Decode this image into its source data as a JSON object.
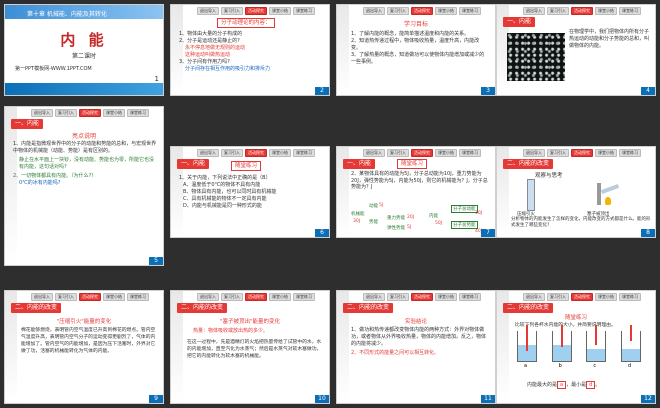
{
  "slides": [
    {
      "num": "1",
      "chapter": "第十章 机械能、内能及其转化",
      "title": "内 能",
      "subtitle": "第二课时",
      "footer": "第一PPT模板网-WWW.1PPT.COM"
    },
    {
      "num": "2",
      "tabs": [
        "退出导入",
        "复习引入",
        "活动探究",
        "课堂小结",
        "课堂练习"
      ],
      "heading": "分子动理论的内容：",
      "items": [
        "1、物体由大量的分子构成的",
        "2、分子是运动还是静止的?",
        "永不停息地做无规则的运动",
        "这种运动叫做热运动",
        "3、分子间有作用力吗?",
        "分子间存在相互作用的吸引力和排斥力"
      ]
    },
    {
      "num": "3",
      "tabs": [
        "退出导入",
        "复习引入",
        "活动探究",
        "课堂小结",
        "课堂练习"
      ],
      "heading": "学习目标",
      "items": [
        "1、了解内能的概念，能简单描述温度和内能的关系。",
        "2、知道热传递过程中，物体吸收热量，温度升高，内能改变。",
        "3、了解热量的概念，知道做功可以使物体内能增加或减少的一些事例。"
      ]
    },
    {
      "num": "4",
      "tabs": [
        "退出导入",
        "复习引入",
        "活动探究",
        "课堂小结",
        "课堂练习"
      ],
      "tag": "一、内能",
      "text": "在物理学中，我们把物体内所有分子热运动的动能和分子势能的总和，叫做物体的内能。"
    },
    {
      "num": "5",
      "tabs": [
        "退出导入",
        "复习引入",
        "活动探究",
        "课堂小结",
        "课堂练习"
      ],
      "tag": "一、内能",
      "heading": "亮点说明",
      "items": [
        "1、内能是指微观世界中的分子的动能和势能的总和，与宏观世界中物体的机械能（动能、势能）是有区别的。",
        "静止在水平面上一块钞，没有动能、势能也为零，所能它也没有内能，这句话对吗?",
        "2、一切物体都具有内能。（为什么?）",
        "0℃的冰有内能吗?"
      ]
    },
    {
      "num": "6",
      "tabs": [
        "退出导入",
        "复习引入",
        "活动探究",
        "课堂小结",
        "课堂练习"
      ],
      "tag": "一、内能",
      "heading": "随堂练习",
      "items": [
        "1、关于内能，下列说法中正确的是（B）",
        "A、温度低于0℃的物体不具有内能",
        "B、物体具有内能，也可以同时具有机械能",
        "C、具有机械能的物体不一定具有内能",
        "D、内能与机械能是同一种形式的能"
      ]
    },
    {
      "num": "7",
      "tabs": [
        "退出导入",
        "复习引入",
        "活动探究",
        "课堂小结",
        "课堂练习"
      ],
      "tag": "一、内能",
      "heading": "随堂练习",
      "items": [
        "2、某物体具有的动能为5J，分子总动能为10J，重力势能为20J，弹性势能为5J，内能为50J，则它的机械能为？J，分子总势能为？J"
      ],
      "labels": [
        "动能",
        "机械能",
        "势能",
        "重力势能",
        "弹性势能",
        "内能",
        "分子总动能",
        "分子总势能",
        "5J",
        "20J",
        "5J",
        "30J",
        "50J",
        "10J",
        "40J"
      ]
    },
    {
      "num": "8",
      "tabs": [
        "退出导入",
        "复习引入",
        "活动探究",
        "课堂小结",
        "课堂练习"
      ],
      "tag": "二、内能的改变",
      "heading": "观察与思考",
      "captions": [
        "压缩引火",
        "塞子被顶出"
      ],
      "text": "分析物体的内能发生了怎样的变化，内能改变的方式都是什么。能的形式发生了哪些变化?"
    },
    {
      "num": "9",
      "tabs": [
        "退出导入",
        "复习引入",
        "活动探究",
        "课堂小结",
        "课堂练习"
      ],
      "tag": "二、内能的改变",
      "heading": "\"压缩引火\"能量的变化",
      "text": "棉花能够燃烧，表明管内空气温度已升高到棉花的燃点。管内空气温度升高，表明管内空气分子的运动变得更剧烈了，气体的内能增加了。管内空气的内能增加，是因为压下活塞时，外界对它做了功，活塞的机械能转化为气体的内能。"
    },
    {
      "num": "10",
      "tabs": [
        "退出导入",
        "复习引入",
        "活动探究",
        "课堂小结",
        "课堂练习"
      ],
      "tag": "二、内能的改变",
      "heading": "\"塞子被顶出\"能量的变化",
      "subheading": "热量：物体吸收或放出热的多少。",
      "text": "在这一过程中，先是酒精灯的火焰把热量传给了试管中的水，水的内能增加，直至汽化为水蒸气；然后是水蒸气对软木塞做功，把它的内能转化为软木塞的机械能。"
    },
    {
      "num": "11",
      "tabs": [
        "退出导入",
        "复习引入",
        "活动探究",
        "课堂小结",
        "课堂练习"
      ],
      "tag": "二、内能的改变",
      "heading": "实验结论",
      "items": [
        "1、做功和热传递都改变物体内能的两种方式：外界对物体做功，或者物体从外界吸收热量，物体的内能增加。反之，物体的内能将减少。",
        "2、不同形式的能量之间可以相互转化。"
      ]
    },
    {
      "num": "12",
      "tabs": [
        "退出导入",
        "复习引入",
        "活动探究",
        "课堂小结",
        "课堂练习"
      ],
      "tag": "二、内能的改变",
      "heading": "随堂练习",
      "text": "比较下列各杯水内能的大小，并简要说明理由。",
      "answer": [
        "内能最大的是",
        "a",
        "，最小是",
        "d",
        "。"
      ],
      "cups": [
        "a",
        "b",
        "c",
        "d"
      ]
    }
  ]
}
